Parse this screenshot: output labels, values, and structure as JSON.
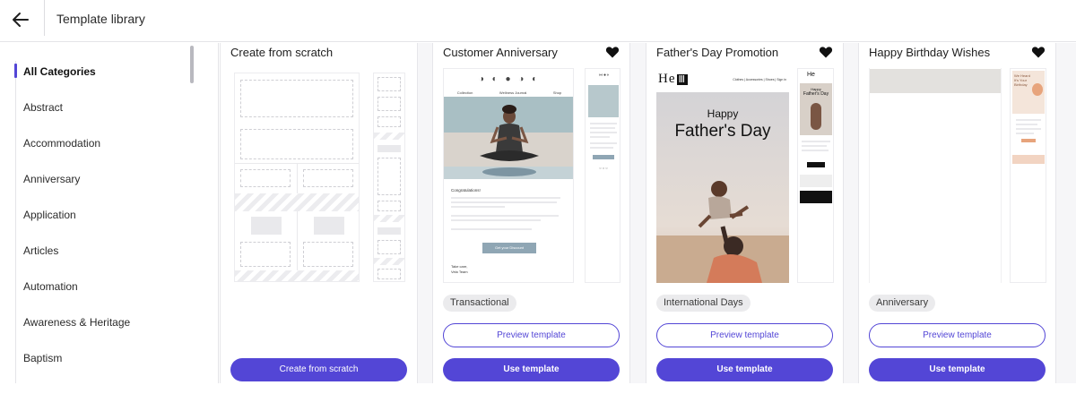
{
  "header": {
    "title": "Template library",
    "back_icon": "arrow-left-icon"
  },
  "sidebar": {
    "categories": [
      {
        "label": "All Categories",
        "active": true
      },
      {
        "label": "Abstract"
      },
      {
        "label": "Accommodation"
      },
      {
        "label": "Anniversary"
      },
      {
        "label": "Application"
      },
      {
        "label": "Articles"
      },
      {
        "label": "Automation"
      },
      {
        "label": "Awareness & Heritage"
      },
      {
        "label": "Baptism"
      }
    ]
  },
  "cards": [
    {
      "title": "Create from scratch",
      "primary_button": "Create from scratch"
    },
    {
      "title": "Customer Anniversary",
      "tag": "Transactional",
      "preview_button": "Preview template",
      "primary_button": "Use template",
      "thumb_text": {
        "nav": [
          "Collection",
          "Wellness Journal",
          "Shop"
        ],
        "greeting": "Congratulations!",
        "cta": "Get your Discount",
        "signoff": "Take care,",
        "team": "Vela Team"
      }
    },
    {
      "title": "Father's Day Promotion",
      "tag": "International Days",
      "preview_button": "Preview template",
      "primary_button": "Use template",
      "thumb_text": {
        "logo": "He",
        "logo_box": "Ⅲ",
        "nav": "Clothes | Accessories | Shoes | Sign in",
        "headline_1": "Happy",
        "headline_2": "Father's Day",
        "side_1": "Happy",
        "side_2": "Father's Day"
      }
    },
    {
      "title": "Happy Birthday Wishes",
      "tag": "Anniversary",
      "preview_button": "Preview template",
      "primary_button": "Use template",
      "thumb_text": {
        "side_heading": "We Heard It's Your Birthday"
      }
    }
  ],
  "colors": {
    "accent": "#5346d6",
    "tag_bg": "#ebebed"
  }
}
